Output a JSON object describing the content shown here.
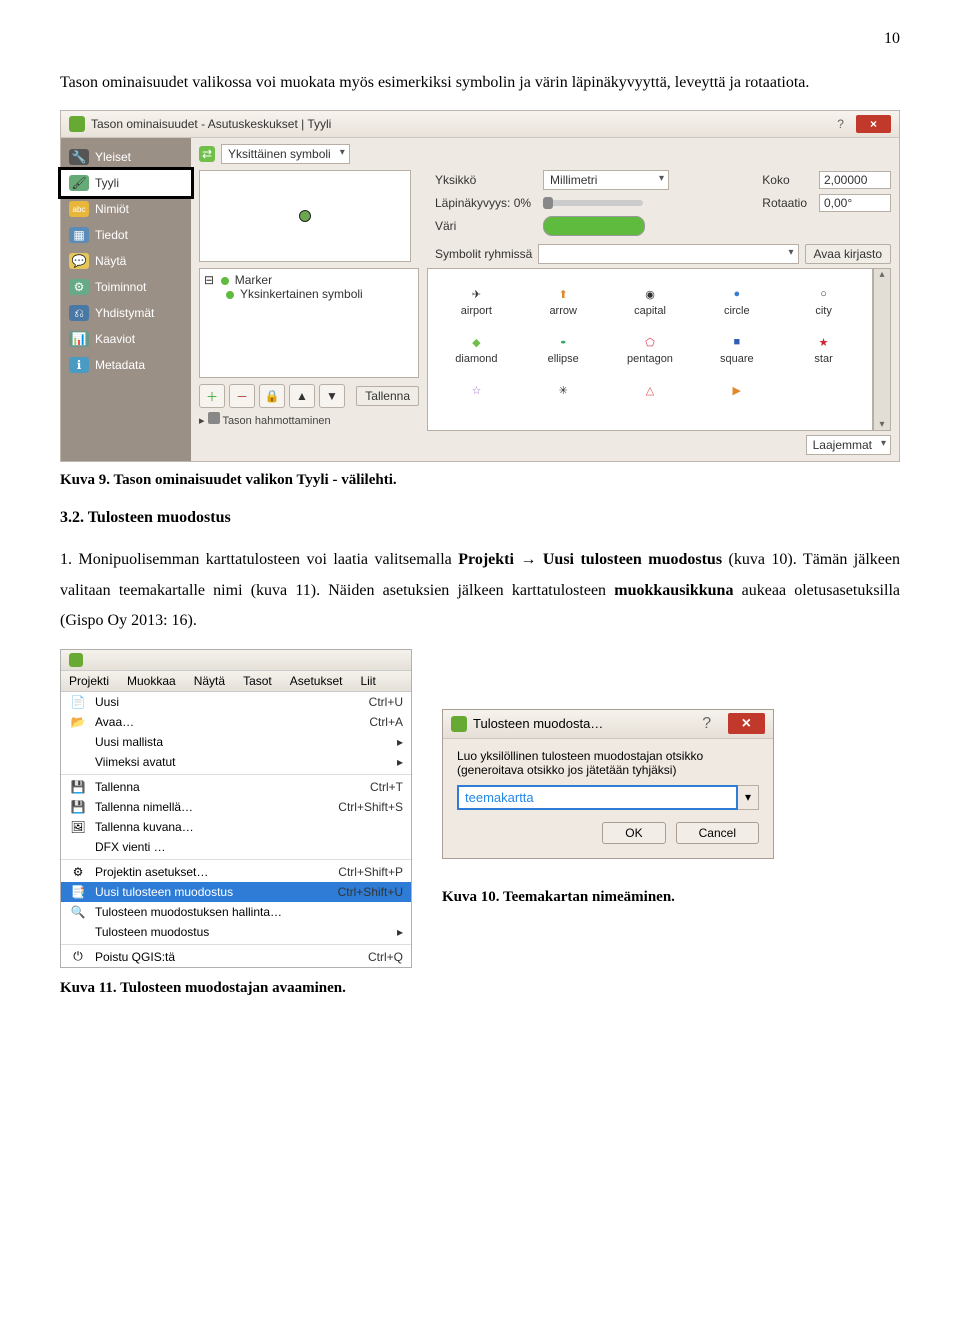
{
  "page_number": "10",
  "intro_paragraph": "Tason ominaisuudet valikossa voi muokata myös esimerkiksi symbolin ja värin läpinäkyvyyttä, leveyttä ja rotaatiota.",
  "caption9": "Kuva 9. Tason ominaisuudet valikon Tyyli - välilehti.",
  "section_heading": "3.2. Tulosteen muodostus",
  "body1a": "1. Monipuolisemman karttatulosteen voi laatia valitsemalla ",
  "body1b": "Projekti",
  "body1c": " → ",
  "body1d": "Uusi tulosteen muodostus",
  "body1e": " (kuva 10). Tämän jälkeen valitaan teemakartalle nimi (kuva 11). Näiden asetuksien jälkeen karttatulosteen ",
  "body1f": "muokkausikkuna",
  "body1g": " aukeaa oletusasetuksilla (Gispo Oy 2013: 16).",
  "caption10": "Kuva 10. Teemakartan nimeäminen.",
  "caption11": "Kuva 11. Tulosteen muodostajan avaaminen.",
  "win1": {
    "title": "Tason ominaisuudet - Asutuskeskukset | Tyyli",
    "help": "?",
    "close": "×",
    "tabs": [
      "Yleiset",
      "Tyyli",
      "Nimiöt",
      "Tiedot",
      "Näytä",
      "Toiminnot",
      "Yhdistymät",
      "Kaaviot",
      "Metadata"
    ],
    "renderer": "Yksittäinen symboli",
    "labels": {
      "unit": "Yksikkö",
      "unit_val": "Millimetri",
      "opacity": "Läpinäkyvyys: 0%",
      "color": "Väri",
      "size": "Koko",
      "size_val": "2,00000",
      "rotation": "Rotaatio",
      "rotation_val": "0,00°",
      "groups": "Symbolit ryhmissä",
      "open_lib": "Avaa kirjasto",
      "marker": "Marker",
      "simple": "Yksinkertainen symboli",
      "save": "Tallenna",
      "advanced": "Laajemmat",
      "preview": "Tason hahmottaminen"
    },
    "symbols": [
      {
        "name": "airport"
      },
      {
        "name": "arrow"
      },
      {
        "name": "capital"
      },
      {
        "name": "circle"
      },
      {
        "name": "city"
      },
      {
        "name": "diamond"
      },
      {
        "name": "ellipse"
      },
      {
        "name": "pentagon"
      },
      {
        "name": "square"
      },
      {
        "name": "star"
      }
    ]
  },
  "win2": {
    "menus": [
      "Projekti",
      "Muokkaa",
      "Näytä",
      "Tasot",
      "Asetukset",
      "Liit"
    ],
    "items": [
      {
        "icon": "file",
        "label": "Uusi",
        "sc": "Ctrl+U"
      },
      {
        "icon": "folder",
        "label": "Avaa…",
        "sc": "Ctrl+A"
      },
      {
        "icon": "",
        "label": "Uusi mallista",
        "arrow": true
      },
      {
        "icon": "",
        "label": "Viimeksi avatut",
        "arrow": true
      },
      {
        "sep": true
      },
      {
        "icon": "disk",
        "label": "Tallenna",
        "sc": "Ctrl+T"
      },
      {
        "icon": "disk",
        "label": "Tallenna nimellä…",
        "sc": "Ctrl+Shift+S"
      },
      {
        "icon": "img",
        "label": "Tallenna kuvana…"
      },
      {
        "icon": "",
        "label": "DFX vienti …"
      },
      {
        "sep": true
      },
      {
        "icon": "gear",
        "label": "Projektin asetukset…",
        "sc": "Ctrl+Shift+P"
      },
      {
        "icon": "doc",
        "label": "Uusi tulosteen muodostus",
        "sc": "Ctrl+Shift+U",
        "sel": true
      },
      {
        "icon": "mag",
        "label": "Tulosteen muodostuksen hallinta…"
      },
      {
        "icon": "",
        "label": "Tulosteen muodostus",
        "arrow": true
      },
      {
        "sep": true
      },
      {
        "icon": "power",
        "label": "Poistu QGIS:tä",
        "sc": "Ctrl+Q"
      }
    ]
  },
  "win3": {
    "title": "Tulosteen muodosta…",
    "help": "?",
    "close": "×",
    "prompt": "Luo yksilöllinen tulosteen muodostajan otsikko (generoitava otsikko jos jätetään tyhjäksi)",
    "value": "teemakartta",
    "ok": "OK",
    "cancel": "Cancel"
  }
}
